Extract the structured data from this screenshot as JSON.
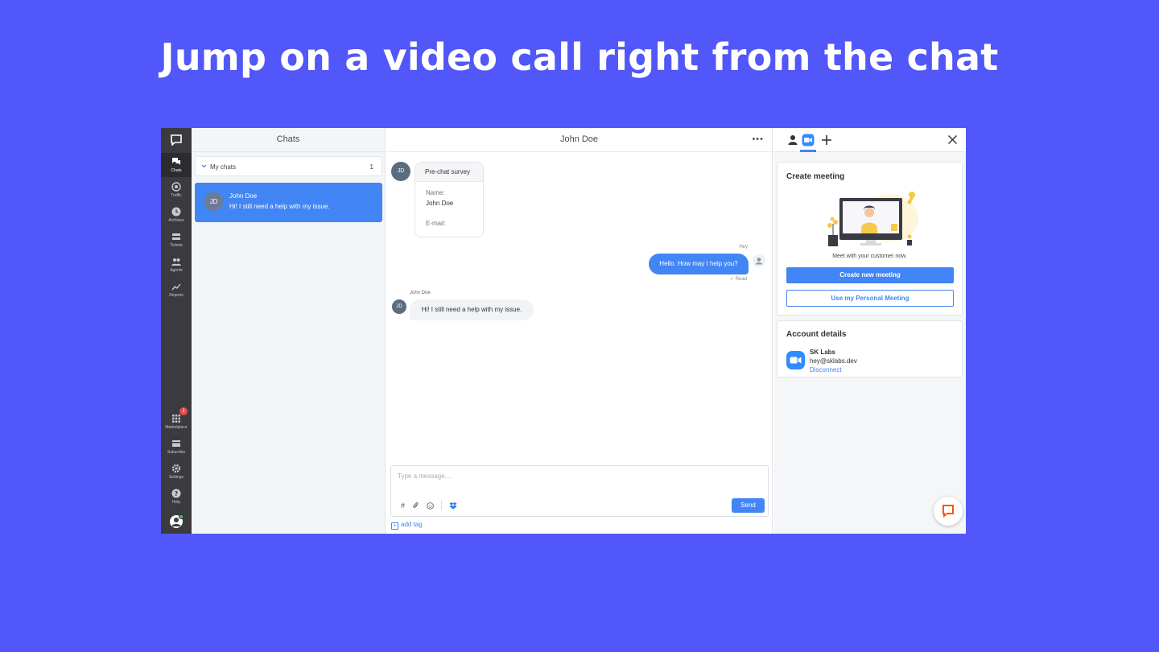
{
  "headline": "Jump on a video call right from the chat",
  "nav": {
    "items": [
      {
        "label": "Chats",
        "icon": "chats-icon"
      },
      {
        "label": "Traffic",
        "icon": "traffic-icon"
      },
      {
        "label": "Archives",
        "icon": "archives-icon"
      },
      {
        "label": "Tickets",
        "icon": "tickets-icon"
      },
      {
        "label": "Agents",
        "icon": "agents-icon"
      },
      {
        "label": "Reports",
        "icon": "reports-icon"
      }
    ],
    "bottom_items": [
      {
        "label": "Marketplace",
        "icon": "marketplace-icon",
        "badge": "1"
      },
      {
        "label": "Subscribe",
        "icon": "subscribe-icon"
      },
      {
        "label": "Settings",
        "icon": "settings-icon"
      },
      {
        "label": "Help",
        "icon": "help-icon"
      }
    ]
  },
  "chats": {
    "title": "Chats",
    "group_label": "My chats",
    "group_count": "1",
    "items": [
      {
        "initials": "JD",
        "name": "John Doe",
        "last_message": "Hi! I still need a help with my issue."
      }
    ]
  },
  "conversation": {
    "title": "John Doe",
    "more": "•••",
    "survey": {
      "title": "Pre-chat survey",
      "name_label": "Name:",
      "name_value": "John Doe",
      "email_label": "E-mail:"
    },
    "messages": [
      {
        "author": "Hey",
        "text": "Hello. How may I help you?",
        "status": "✓ Read"
      },
      {
        "author": "John Doe",
        "initials": "JD",
        "text": "Hi! I still need a help with my issue."
      }
    ],
    "composer_placeholder": "Type a message....",
    "send_label": "Send",
    "add_tag": "add tag"
  },
  "right_panel": {
    "create_meeting": {
      "title": "Create meeting",
      "caption": "Meet with your customer now.",
      "primary_button": "Create new meeting",
      "secondary_button": "Use my Personal Meeting"
    },
    "account": {
      "title": "Account details",
      "name": "SK Labs",
      "email": "hey@sklabs.dev",
      "disconnect": "Disconnect"
    }
  },
  "colors": {
    "background": "#5157f8",
    "accent": "#4285f4",
    "nav": "#3a3a3f"
  }
}
